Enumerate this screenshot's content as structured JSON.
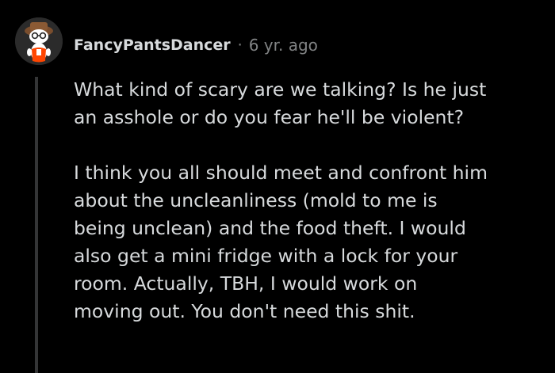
{
  "comment": {
    "author": "FancyPantsDancer",
    "separator": "·",
    "timestamp": "6 yr. ago",
    "avatar_icon": "snoo-avatar-icon",
    "paragraphs": [
      [
        "What kind of scary are we talking? Is he just",
        "an asshole or do you fear he'll be violent?"
      ],
      [
        "I think you all should meet and confront him",
        "about the uncleanliness (mold to me is",
        "being unclean) and the food theft. I would",
        "also get a mini fridge with a lock for your",
        "room. Actually, TBH, I would work on",
        "moving out. You don't need this shit."
      ]
    ]
  },
  "colors": {
    "background": "#000000",
    "text": "#d7dadc",
    "meta": "#818384",
    "thread_line": "#343536",
    "avatar_accent": "#ff4500"
  }
}
